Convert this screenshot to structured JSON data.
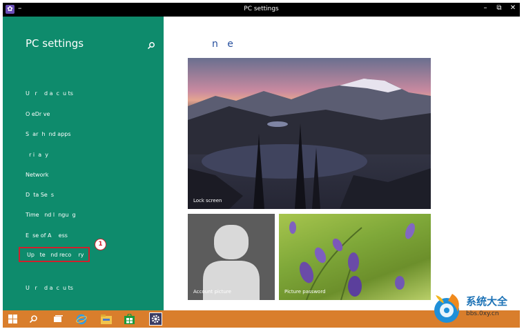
{
  "window": {
    "title": "PC settings",
    "menu_glyph": "–",
    "controls": {
      "minimize": "–",
      "restore": "⧉",
      "close": "✕"
    }
  },
  "sidebar": {
    "title": "PC settings",
    "items": [
      {
        "label": "U   r    d a  c  u ts"
      },
      {
        "label": "O eDr ve"
      },
      {
        "label": "S  ar  h  nd apps"
      },
      {
        "label": "  r i  a  y"
      },
      {
        "label": "Network"
      },
      {
        "label": "D  ta Se  s"
      },
      {
        "label": "Time   nd l  ngu  g"
      },
      {
        "label": "E  se of A    ess"
      },
      {
        "label": "Up   te   nd reco    ry",
        "selected": true
      },
      {
        "label": "U   r    d a  c  u ts"
      }
    ],
    "annotation_number": "1"
  },
  "main": {
    "heading": "n   e",
    "tiles": {
      "lock_screen": "Lock screen",
      "account_picture": "Account picture",
      "picture_password": "Picture password"
    }
  },
  "taskbar": {
    "icons": [
      "start-icon",
      "search-icon",
      "task-view-icon",
      "internet-explorer-icon",
      "file-explorer-icon",
      "store-icon",
      "settings-icon"
    ]
  },
  "watermark": {
    "name": "系统大全",
    "url": "bbs.0xy.cn"
  },
  "colors": {
    "sidebar": "#0e8b6c",
    "taskbar": "#d97e2c",
    "highlight_box": "#d11f2c",
    "heading": "#264f9e"
  }
}
